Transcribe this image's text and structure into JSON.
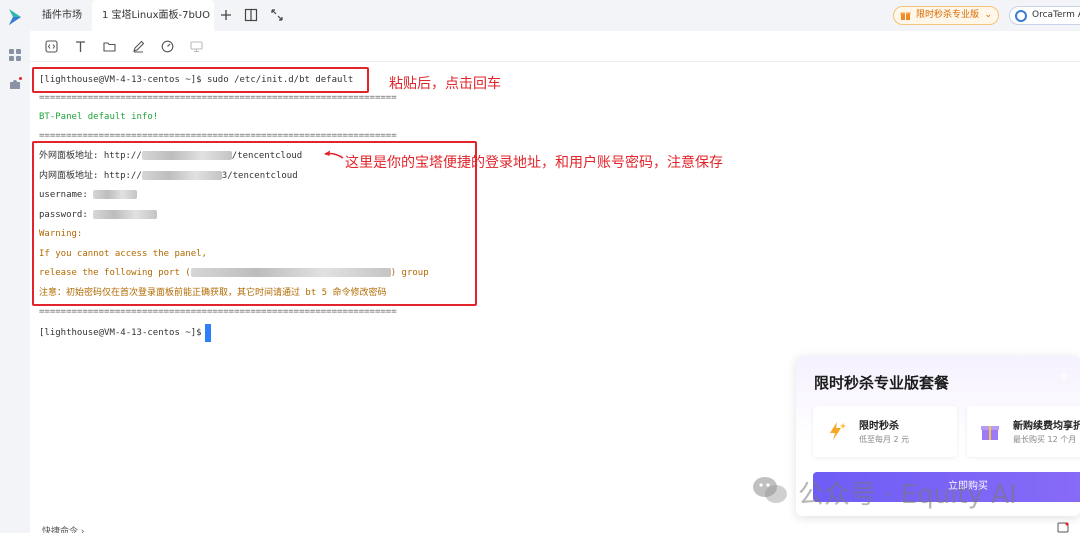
{
  "tabs": {
    "plugins": "插件市场",
    "active": "1  宝塔Linux面板-7bUO"
  },
  "header": {
    "promo_label": "限时秒杀专业版",
    "orca_label": "OrcaTerm A"
  },
  "terminal": {
    "cmd_line": "[lighthouse@VM-4-13-centos ~]$ sudo /etc/init.d/bt default",
    "sep": "==================================================================",
    "info": "BT-Panel default info!",
    "outer_label": "外网面板地址: http://",
    "outer_suffix": "/tencentcloud",
    "inner_label": "内网面板地址: http://",
    "inner_suffix": "3/tencentcloud",
    "username_label": "username: ",
    "password_label": "password: ",
    "warning": "Warning:",
    "warn1": "If you cannot access the panel,",
    "warn2_prefix": "release the following port (",
    "warn2_suffix": ") group",
    "note": "注意：初始密码仅在首次登录面板前能正确获取，其它时间请通过 bt 5 命令修改密码",
    "prompt": "[lighthouse@VM-4-13-centos ~]$"
  },
  "annotations": {
    "paste": "粘贴后，点击回车",
    "address": "这里是你的宝塔便捷的登录地址，和用户账号密码，注意保存"
  },
  "promo_card": {
    "title": "限时秒杀专业版套餐",
    "item1_title": "限时秒杀",
    "item1_desc": "低至每月 2 元",
    "item2_title": "新购续费均享折",
    "item2_desc": "最长购买 12 个月",
    "buy_label": "立即购买"
  },
  "watermark": "公众号 · Equity AI",
  "status_bar": "快捷命令 ›",
  "colors": {
    "accent_red": "#e3242b",
    "terminal_green": "#22a33a",
    "warning_orange": "#b26a00",
    "cursor_blue": "#2d7ff9",
    "buy_purple": "#6d5df6"
  }
}
